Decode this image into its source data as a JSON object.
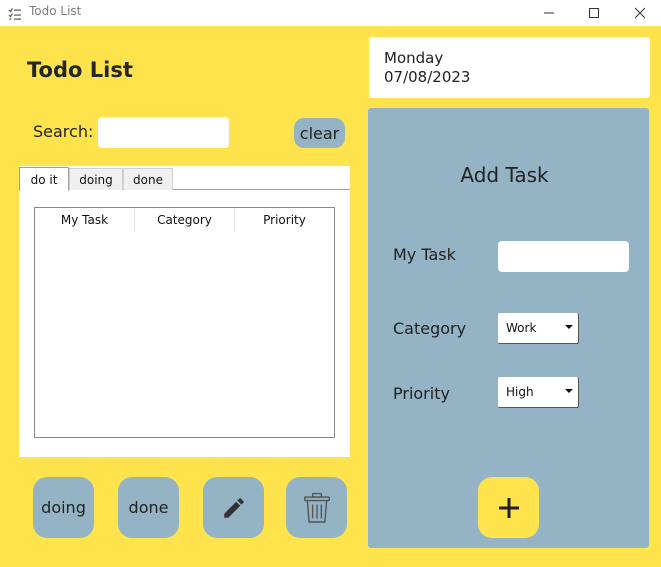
{
  "window": {
    "title": "Todo List",
    "icons": {
      "app": "checklist-icon",
      "minimize": "minimize-icon",
      "maximize": "maximize-icon",
      "close": "close-icon"
    }
  },
  "header": {
    "title": "Todo List"
  },
  "date": {
    "day": "Monday",
    "value": "07/08/2023"
  },
  "search": {
    "label": "Search:",
    "value": "",
    "clear_label": "clear"
  },
  "tabs": [
    {
      "label": "do it",
      "active": true
    },
    {
      "label": "doing",
      "active": false
    },
    {
      "label": "done",
      "active": false
    }
  ],
  "table": {
    "columns": [
      "My Task",
      "Category",
      "Priority"
    ],
    "rows": []
  },
  "actions": {
    "doing_label": "doing",
    "done_label": "done",
    "edit_icon": "pencil-icon",
    "delete_icon": "trash-icon"
  },
  "add_task": {
    "title": "Add Task",
    "task_label": "My Task",
    "task_value": "",
    "category_label": "Category",
    "category_value": "Work",
    "priority_label": "Priority",
    "priority_value": "High",
    "add_icon": "plus-icon"
  },
  "colors": {
    "background": "#ffe34d",
    "panel": "#94b4c6",
    "button": "#94b4c6",
    "add_button": "#ffe34d"
  }
}
